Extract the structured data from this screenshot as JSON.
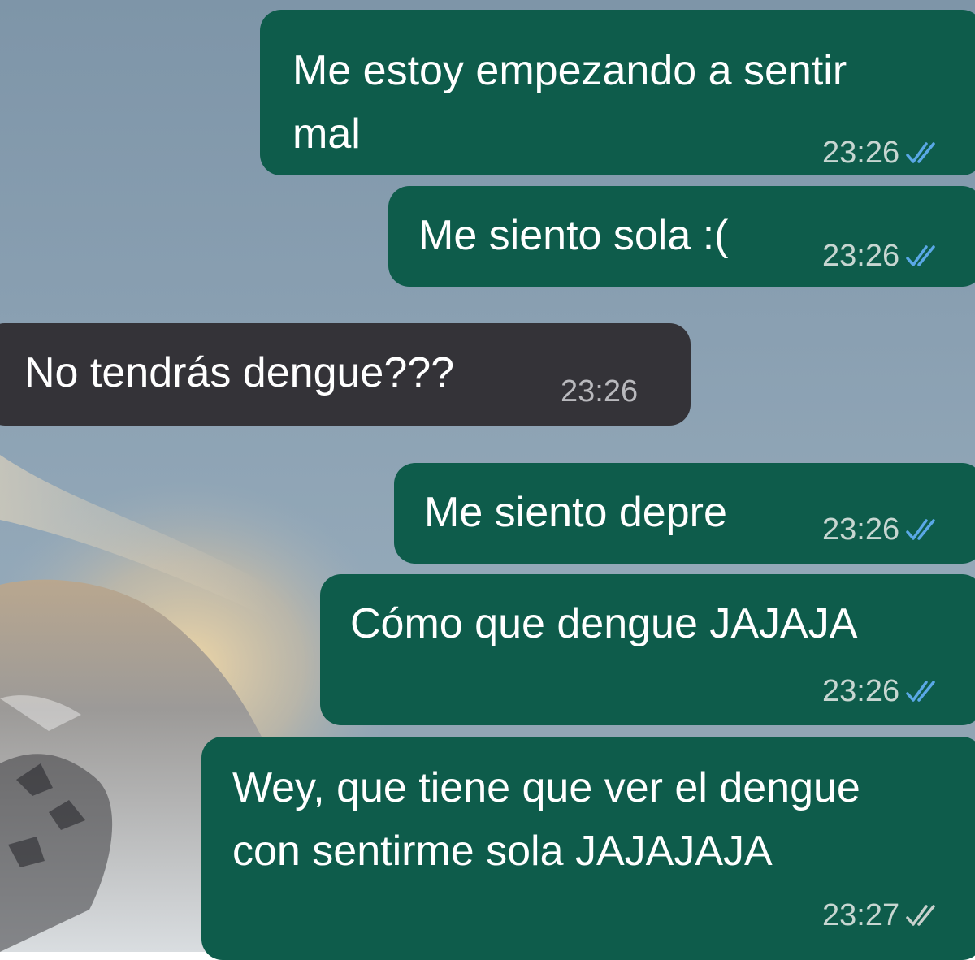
{
  "chat": {
    "colors": {
      "outgoing_bubble": "#0e5c4b",
      "incoming_bubble": "#343338",
      "read_ticks": "#5aa8e6",
      "delivered_ticks": "#c7d0cc"
    },
    "messages": [
      {
        "direction": "outgoing",
        "lines": [
          "Me estoy empezando a sentir",
          "mal"
        ],
        "time": "23:26",
        "status": "read"
      },
      {
        "direction": "outgoing",
        "lines": [
          "Me siento sola :("
        ],
        "time": "23:26",
        "status": "read"
      },
      {
        "direction": "incoming",
        "lines": [
          "No tendrás dengue???"
        ],
        "time": "23:26"
      },
      {
        "direction": "outgoing",
        "lines": [
          "Me siento depre"
        ],
        "time": "23:26",
        "status": "read"
      },
      {
        "direction": "outgoing",
        "lines": [
          "Cómo que dengue JAJAJA"
        ],
        "time": "23:26",
        "status": "read"
      },
      {
        "direction": "outgoing",
        "lines": [
          "Wey, que tiene que ver el dengue",
          "con sentirme sola JAJAJAJA"
        ],
        "time": "23:27",
        "status": "delivered"
      }
    ]
  }
}
